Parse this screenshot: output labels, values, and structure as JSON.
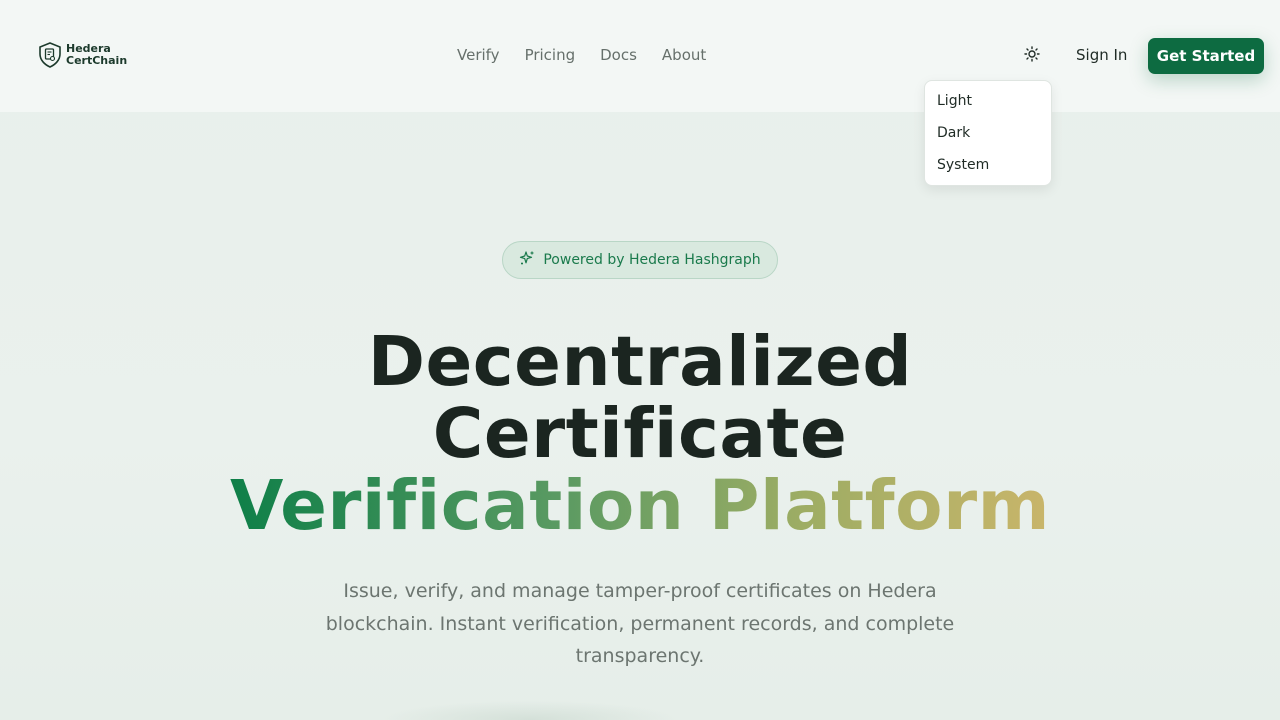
{
  "brand": {
    "line1": "Hedera",
    "line2": "CertChain",
    "logo_icon": "shield-certificate-icon"
  },
  "nav": {
    "items": [
      {
        "label": "Verify"
      },
      {
        "label": "Pricing"
      },
      {
        "label": "Docs"
      },
      {
        "label": "About"
      }
    ]
  },
  "header": {
    "theme_icon": "sun-icon",
    "signin_label": "Sign In",
    "cta_label": "Get Started"
  },
  "theme_menu": {
    "options": [
      {
        "label": "Light"
      },
      {
        "label": "Dark"
      },
      {
        "label": "System"
      }
    ]
  },
  "hero": {
    "badge_icon": "sparkles-icon",
    "badge_text": "Powered by Hedera Hashgraph",
    "headline_line1": "Decentralized",
    "headline_line2": "Certificate",
    "headline_accent": "Verification Platform",
    "subtitle": "Issue, verify, and manage tamper-proof certificates on Hedera blockchain. Instant verification, permanent records, and complete transparency."
  },
  "colors": {
    "primary": "#0d6b41",
    "accent_start": "#0e7f48",
    "accent_end": "#c9b56a",
    "background": "#e9f0ec"
  }
}
